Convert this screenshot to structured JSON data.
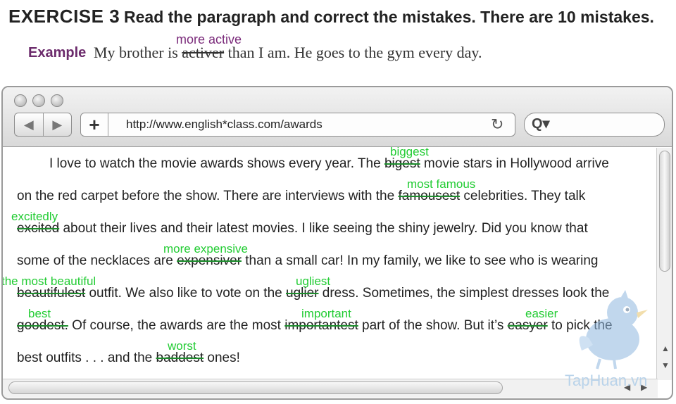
{
  "header": {
    "exercise_title": "EXERCISE 3",
    "instruction": "Read the paragraph and correct the mistakes. There are 10 mistakes."
  },
  "example": {
    "label": "Example",
    "before": "My brother is ",
    "wrong": "activer",
    "after": " than I am. He goes to the gym every day.",
    "correction": "more active"
  },
  "browser": {
    "url": "http://www.english*class.com/awards",
    "back_icon": "back-arrow-icon",
    "forward_icon": "forward-arrow-icon",
    "add_icon": "plus-icon",
    "reload_icon": "reload-icon",
    "search_icon": "search-icon"
  },
  "paragraph": {
    "l1a": "I love to watch the movie awards shows every year. The ",
    "l1m": "bigest",
    "l1b": " movie stars in Hollywood arrive",
    "l2a": "on the red carpet before the show. There are interviews with the ",
    "l2m": "famousest",
    "l2b": " celebrities. They talk",
    "l3m": "excited",
    "l3b": " about their lives and their latest movies. I like seeing the shiny jewelry. Did you know that",
    "l4a": "some of the necklaces are ",
    "l4m": "expensiver",
    "l4b": " than a small car! In my family, we like to see who is wearing",
    "l5m1": "beautifulest",
    "l5a": " outfit. We also like to vote on the ",
    "l5m2": "uglier",
    "l5b": " dress. Sometimes, the simplest dresses look the",
    "l6m1": "goodest.",
    "l6a": " Of course, the awards are the most ",
    "l6m2": "importantest",
    "l6b": " part of the show. But it’s ",
    "l6m3": "easyer",
    "l6c": " to pick the",
    "l7a": "best outfits . . . and the ",
    "l7m": "baddest",
    "l7b": " ones!"
  },
  "corrections": {
    "c1": "biggest",
    "c2": "most famous",
    "c3": "excitedly",
    "c4": "more expensive",
    "c5": "the most beautiful",
    "c6": "ugliest",
    "c7": "best",
    "c8": "important",
    "c9": "easier",
    "c10": "worst"
  },
  "watermark": "TapHuan.vn",
  "colors": {
    "correction_green": "#22cc33",
    "example_purple": "#6b2a6b"
  }
}
